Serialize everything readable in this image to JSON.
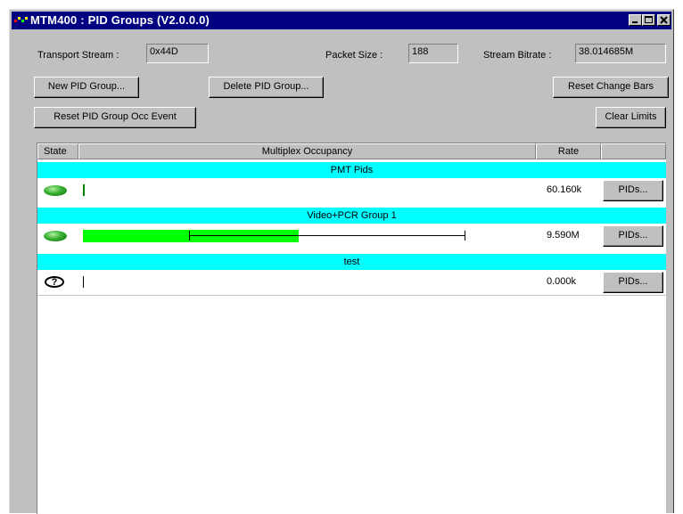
{
  "window": {
    "title": "MTM400 : PID Groups (V2.0.0.0)"
  },
  "fields": {
    "transport_stream_label": "Transport Stream :",
    "transport_stream_value": "0x44D",
    "packet_size_label": "Packet Size :",
    "packet_size_value": "188",
    "stream_bitrate_label": "Stream Bitrate :",
    "stream_bitrate_value": "38.014685M"
  },
  "buttons": {
    "new_pid_group": "New PID Group...",
    "delete_pid_group": "Delete PID Group...",
    "reset_change_bars": "Reset Change Bars",
    "reset_occ_event": "Reset PID Group Occ Event",
    "clear_limits": "Clear Limits"
  },
  "table": {
    "headers": [
      "State",
      "Multiplex Occupancy",
      "Rate",
      ""
    ],
    "groups": [
      {
        "name": "PMT Pids",
        "state": "ok",
        "rate": "60.160k",
        "pids_label": "PIDs...",
        "occupancy_fraction": 0.004,
        "bar_color": "#008000"
      },
      {
        "name": "Video+PCR Group 1",
        "state": "ok",
        "rate": "9.590M",
        "pids_label": "PIDs...",
        "occupancy_fraction": 0.52,
        "limit_min_fraction": 0.255,
        "limit_max_fraction": 0.92,
        "bar_color": "#00ff00"
      },
      {
        "name": "test",
        "state": "unknown",
        "state_symbol": "?",
        "rate": "0.000k",
        "pids_label": "PIDs...",
        "occupancy_fraction": 0.002,
        "bar_color": "#000000"
      }
    ]
  },
  "colors": {
    "title_bar": "#000080",
    "group_row": "#00ffff",
    "face": "#c0c0c0"
  }
}
